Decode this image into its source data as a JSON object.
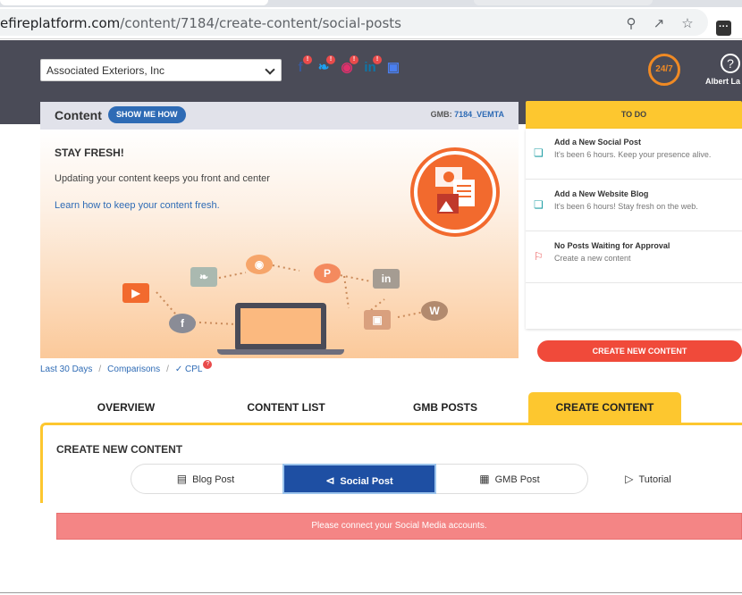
{
  "browser": {
    "url_host": "efireplatform.com",
    "url_path": "/content/7184/create-content/social-posts",
    "extension_label": "···"
  },
  "header": {
    "account_select": "Associated Exteriors, Inc",
    "social_icons": [
      "facebook-icon",
      "twitter-icon",
      "instagram-icon",
      "linkedin-icon",
      "google-my-business-icon"
    ],
    "support_label": "24/7",
    "help_label": "?",
    "user_name": "Albert La"
  },
  "content_card": {
    "title": "Content",
    "show_me_how": "SHOW ME HOW",
    "gmb_label": "GMB:",
    "gmb_value": "7184_VEMTA",
    "headline": "STAY FRESH!",
    "description": "Updating your content keeps you front and center",
    "learn_link": "Learn how to keep your content fresh."
  },
  "todo": {
    "header": "TO DO",
    "items": [
      {
        "title": "Add a New Social Post",
        "desc": "It's been 6 hours. Keep your presence alive.",
        "icon": "add-post-icon"
      },
      {
        "title": "Add a New Website Blog",
        "desc": "It's been 6 hours! Stay fresh on the web.",
        "icon": "add-blog-icon"
      },
      {
        "title": "No Posts Waiting for Approval",
        "desc": "Create a new content",
        "icon": "flag-icon"
      }
    ],
    "create_button": "CREATE NEW CONTENT"
  },
  "filters": {
    "range": "Last 30 Days",
    "comparisons": "Comparisons",
    "cpl": "CPL",
    "cpl_badge": "?"
  },
  "tabs": [
    "OVERVIEW",
    "CONTENT LIST",
    "GMB POSTS",
    "CREATE CONTENT"
  ],
  "panel": {
    "title": "CREATE NEW CONTENT",
    "options": [
      "Blog Post",
      "Social Post",
      "GMB Post",
      "Tutorial"
    ]
  },
  "alert": "Please connect your Social Media accounts.",
  "colors": {
    "header_bg": "#4a4b57",
    "accent_yellow": "#fdc72f",
    "primary_blue": "#1e4fa3",
    "create_red": "#f04a3a",
    "alert_pink": "#f48585"
  }
}
